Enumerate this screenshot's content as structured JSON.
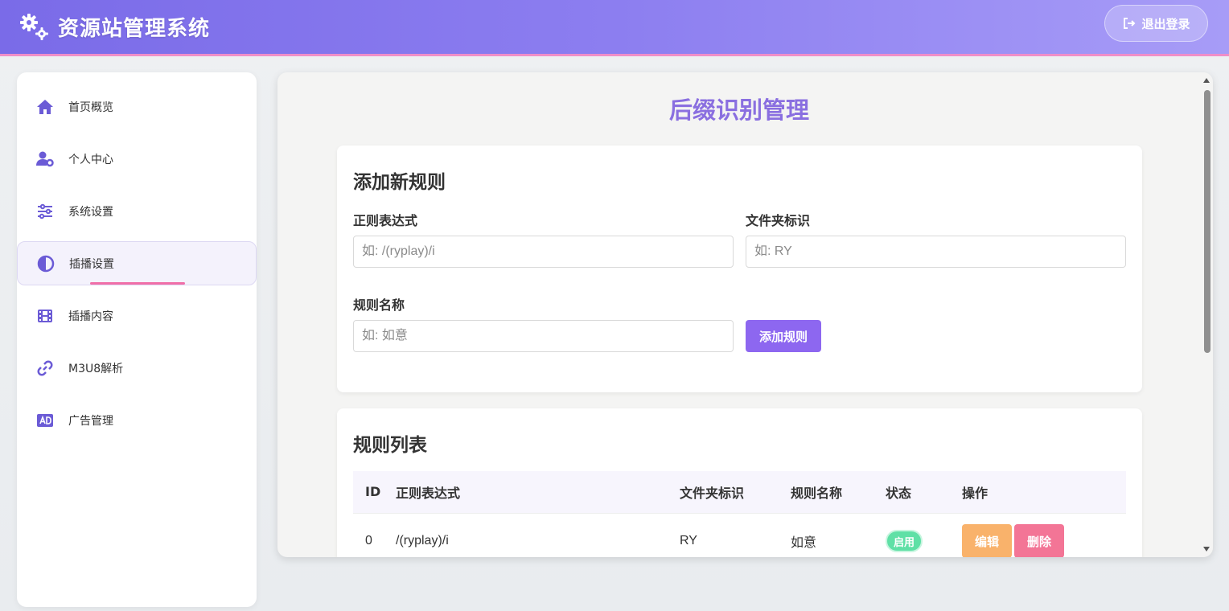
{
  "header": {
    "title": "资源站管理系统",
    "logout_label": "退出登录",
    "colors": {
      "gradient_start": "#7a6be8",
      "gradient_end": "#a79cf7",
      "accent_line": "#f08ec8"
    }
  },
  "sidebar": {
    "items": [
      {
        "label": "首页概览",
        "icon": "home-icon"
      },
      {
        "label": "个人中心",
        "icon": "user-gear-icon"
      },
      {
        "label": "系统设置",
        "icon": "sliders-icon"
      },
      {
        "label": "插播设置",
        "icon": "half-circle-icon",
        "active": true
      },
      {
        "label": "插播内容",
        "icon": "film-icon"
      },
      {
        "label": "M3U8解析",
        "icon": "link-icon"
      },
      {
        "label": "广告管理",
        "icon": "ad-icon"
      }
    ]
  },
  "main": {
    "title": "后缀识别管理",
    "add_form": {
      "heading": "添加新规则",
      "regex_label": "正则表达式",
      "regex_placeholder": "如: /(ryplay)/i",
      "folder_label": "文件夹标识",
      "folder_placeholder": "如: RY",
      "name_label": "规则名称",
      "name_placeholder": "如: 如意",
      "submit_label": "添加规则"
    },
    "rule_list": {
      "heading": "规则列表",
      "columns": [
        "ID",
        "正则表达式",
        "文件夹标识",
        "规则名称",
        "状态",
        "操作"
      ],
      "rows": [
        {
          "id": "0",
          "regex": "/(ryplay)/i",
          "folder": "RY",
          "name": "如意",
          "status": "启用",
          "edit_label": "编辑",
          "delete_label": "删除"
        }
      ]
    }
  }
}
